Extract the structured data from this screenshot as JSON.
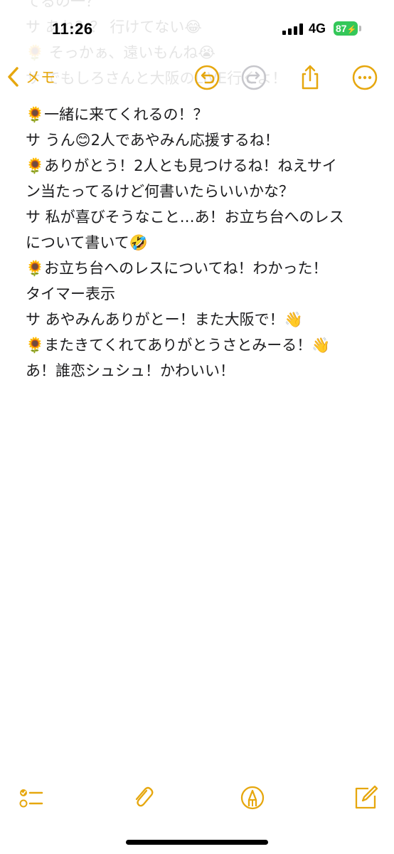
{
  "status_bar": {
    "time": "11:26",
    "network": "4G",
    "battery": "87",
    "battery_color": "#34c759"
  },
  "nav": {
    "back_label": "メモ",
    "accent_color": "#e6a70e",
    "icons": [
      "chevron-left-icon",
      "undo-icon",
      "redo-icon",
      "share-icon",
      "more-icon"
    ]
  },
  "ghost_text": [
    "てるの一？",
    "サ あれ？？ 行けてない😂",
    "🌻 そっかぁ、遠いもんね😭",
    "サ でもしろさんと大阪のLIVE行くよ！"
  ],
  "note": {
    "lines": [
      "🌻一緒に来てくれるの！？",
      "サ うん😊2人であやみん応援するね！",
      "🌻ありがとう！2人とも見つけるね！ねえサイ",
      "ン当たってるけど何書いたらいいかな？",
      "サ 私が喜びそうなこと…あ！お立ち台へのレス",
      "について書いて🤣",
      "🌻お立ち台へのレスについてね！わかった！",
      "タイマー表示",
      "サ あやみんありがとー！また大阪で！👋",
      "🌻またきてくれてありがとうさとみーる！👋",
      "あ！誰恋シュシュ！かわいい！"
    ]
  },
  "toolbar": {
    "icons": [
      "checklist-icon",
      "attachment-icon",
      "markup-icon",
      "compose-icon"
    ]
  }
}
